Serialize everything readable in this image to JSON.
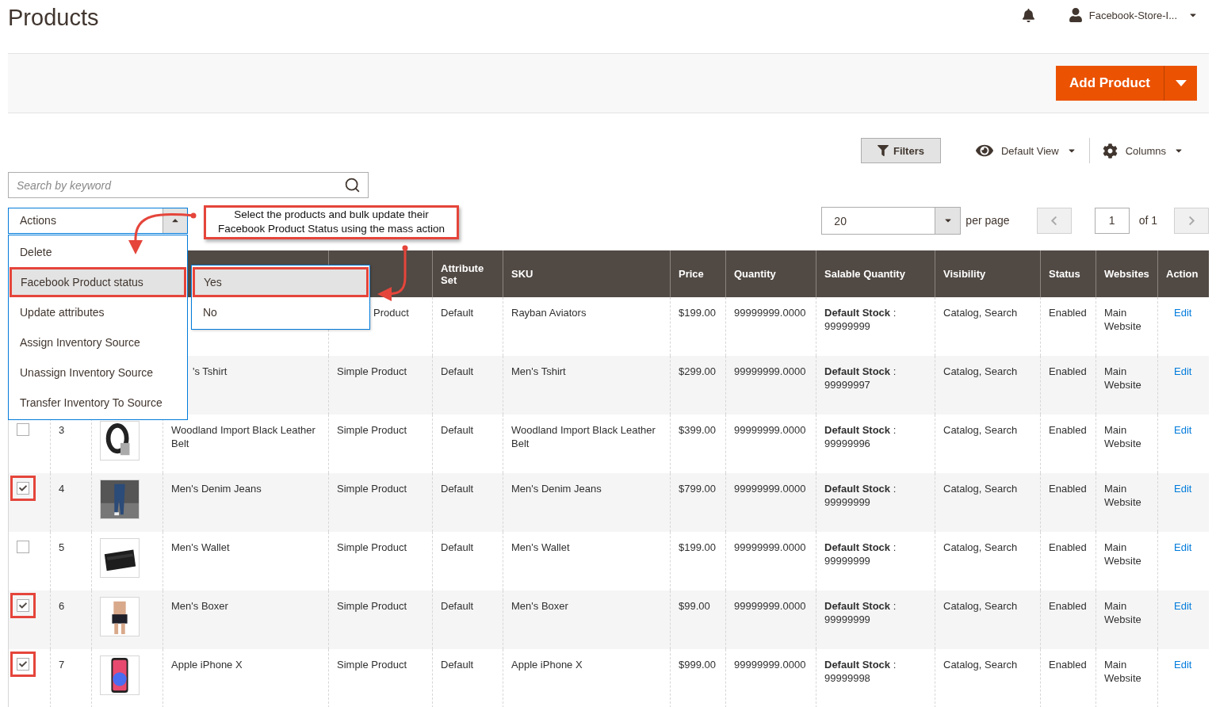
{
  "page_title": "Products",
  "header": {
    "user": "Facebook-Store-I..."
  },
  "primary_action": {
    "label": "Add Product"
  },
  "toolbar": {
    "filters": "Filters",
    "view": "Default View",
    "columns": "Columns"
  },
  "search": {
    "placeholder": "Search by keyword"
  },
  "actions": {
    "label": "Actions",
    "expanded": true,
    "items": [
      {
        "label": "Delete",
        "selected": false
      },
      {
        "label": "Facebook Product status",
        "selected": true
      },
      {
        "label": "Update attributes",
        "selected": false
      },
      {
        "label": "Assign Inventory Source",
        "selected": false
      },
      {
        "label": "Unassign Inventory Source",
        "selected": false
      },
      {
        "label": "Transfer Inventory To Source",
        "selected": false
      }
    ]
  },
  "submenu": {
    "items": [
      {
        "label": "Yes",
        "selected": true
      },
      {
        "label": "No",
        "selected": false
      }
    ]
  },
  "callout": "Select the products and bulk update their\nFacebook Product Status using the mass action",
  "pagination": {
    "per_page": "20",
    "per_page_label": "per page",
    "page": "1",
    "of": "of 1"
  },
  "table": {
    "columns": [
      {},
      {},
      {},
      {},
      {},
      {
        "label": "Attribute Set"
      },
      {
        "label": "SKU"
      },
      {
        "label": "Price"
      },
      {
        "label": "Quantity"
      },
      {
        "label": "Salable Quantity"
      },
      {
        "label": "Visibility"
      },
      {
        "label": "Status"
      },
      {
        "label": "Websites"
      },
      {
        "label": "Action"
      }
    ],
    "rows": [
      {
        "type": "Product",
        "type_cut": true,
        "attribute_set": "Default",
        "sku": "Rayban Aviators",
        "price": "$199.00",
        "quantity": "99999999.0000",
        "salable": "**Default Stock** : 99999999",
        "visibility": "Catalog, Search",
        "status": "Enabled",
        "websites": "Main Website",
        "action": "Edit"
      },
      {
        "name": "'s Tshirt",
        "type": "Simple Product",
        "attribute_set": "Default",
        "sku": "Men's Tshirt",
        "price": "$299.00",
        "quantity": "99999999.0000",
        "salable": "**Default Stock** : 99999997",
        "visibility": "Catalog, Search",
        "status": "Enabled",
        "websites": "Main Website",
        "action": "Edit"
      },
      {
        "checked": false,
        "id": "3",
        "name": "Woodland Import Black Leather Belt",
        "type": "Simple Product",
        "attribute_set": "Default",
        "sku": "Woodland Import Black Leather Belt",
        "price": "$399.00",
        "quantity": "99999999.0000",
        "salable": "**Default Stock** : 99999996",
        "visibility": "Catalog, Search",
        "status": "Enabled",
        "websites": "Main Website",
        "action": "Edit"
      },
      {
        "checked": true,
        "id": "4",
        "name": "Men's Denim Jeans",
        "type": "Simple Product",
        "attribute_set": "Default",
        "sku": "Men's Denim Jeans",
        "price": "$799.00",
        "quantity": "99999999.0000",
        "salable": "**Default Stock** : 99999999",
        "visibility": "Catalog, Search",
        "status": "Enabled",
        "websites": "Main Website",
        "action": "Edit"
      },
      {
        "checked": false,
        "id": "5",
        "name": "Men's Wallet",
        "type": "Simple Product",
        "attribute_set": "Default",
        "sku": "Men's Wallet",
        "price": "$199.00",
        "quantity": "99999999.0000",
        "salable": "**Default Stock** : 99999999",
        "visibility": "Catalog, Search",
        "status": "Enabled",
        "websites": "Main Website",
        "action": "Edit"
      },
      {
        "checked": true,
        "id": "6",
        "name": "Men's Boxer",
        "type": "Simple Product",
        "attribute_set": "Default",
        "sku": "Men's Boxer",
        "price": "$99.00",
        "quantity": "99999999.0000",
        "salable": "**Default Stock** : 99999999",
        "visibility": "Catalog, Search",
        "status": "Enabled",
        "websites": "Main Website",
        "action": "Edit"
      },
      {
        "checked": true,
        "id": "7",
        "name": "Apple iPhone X",
        "type": "Simple Product",
        "attribute_set": "Default",
        "sku": "Apple iPhone X",
        "price": "$999.00",
        "quantity": "99999999.0000",
        "salable": "**Default Stock** : 99999998",
        "visibility": "Catalog, Search",
        "status": "Enabled",
        "websites": "Main Website",
        "action": "Edit"
      }
    ]
  }
}
